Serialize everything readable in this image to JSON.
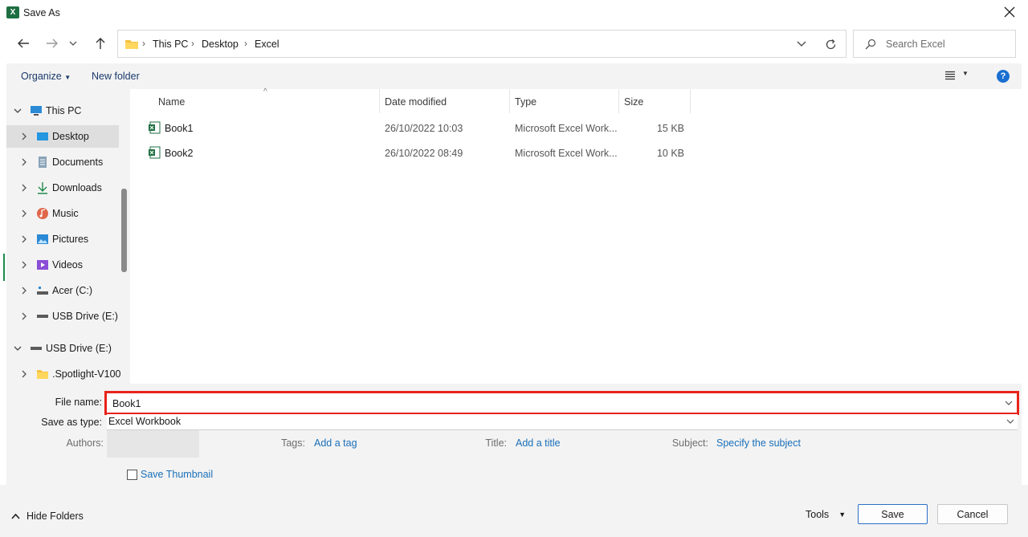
{
  "window": {
    "title": "Save As",
    "app_icon_letter": "X"
  },
  "address": {
    "crumbs": [
      "This PC",
      "Desktop",
      "Excel"
    ]
  },
  "search": {
    "placeholder": "Search Excel"
  },
  "commands": {
    "organize": "Organize",
    "new_folder": "New folder",
    "help": "?"
  },
  "nav": {
    "items": [
      {
        "label": "This PC",
        "icon": "computer-icon"
      },
      {
        "label": "Desktop",
        "icon": "desktop-icon"
      },
      {
        "label": "Documents",
        "icon": "documents-icon"
      },
      {
        "label": "Downloads",
        "icon": "downloads-icon"
      },
      {
        "label": "Music",
        "icon": "music-icon"
      },
      {
        "label": "Pictures",
        "icon": "pictures-icon"
      },
      {
        "label": "Videos",
        "icon": "videos-icon"
      },
      {
        "label": "Acer (C:)",
        "icon": "drive-icon"
      },
      {
        "label": "USB Drive (E:)",
        "icon": "usb-drive-icon"
      },
      {
        "label": "USB Drive (E:)",
        "icon": "usb-drive-icon"
      },
      {
        "label": ".Spotlight-V100",
        "icon": "folder-icon"
      }
    ]
  },
  "files": {
    "columns": [
      "Name",
      "Date modified",
      "Type",
      "Size"
    ],
    "rows": [
      {
        "name": "Book1",
        "date": "26/10/2022 10:03",
        "type": "Microsoft Excel Work...",
        "size": "15 KB"
      },
      {
        "name": "Book2",
        "date": "26/10/2022 08:49",
        "type": "Microsoft Excel Work...",
        "size": "10 KB"
      }
    ]
  },
  "form": {
    "filename_label": "File name:",
    "filename_value": "Book1",
    "savetype_label": "Save as type:",
    "savetype_value": "Excel Workbook",
    "authors_label": "Authors:",
    "tags_label": "Tags:",
    "tags_link": "Add a tag",
    "title_label": "Title:",
    "title_link": "Add a title",
    "subject_label": "Subject:",
    "subject_link": "Specify the subject",
    "thumbnail_label": "Save Thumbnail",
    "highlight_color": "#e8231b"
  },
  "footer": {
    "hide_folders": "Hide Folders",
    "tools": "Tools",
    "save": "Save",
    "cancel": "Cancel"
  }
}
